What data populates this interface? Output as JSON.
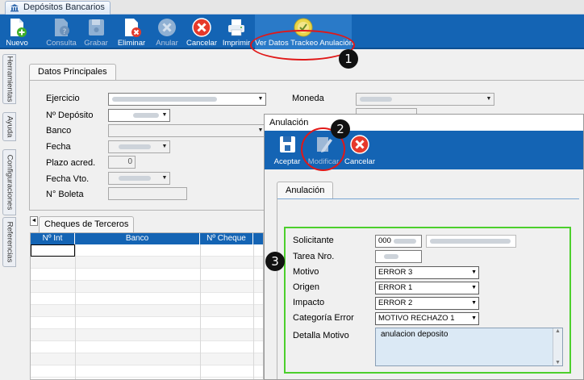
{
  "window": {
    "tab_title": "Depósitos Bancarios"
  },
  "toolbar": {
    "buttons": [
      {
        "label": "Nuevo",
        "icon": "new-document-icon"
      },
      {
        "label": "Consulta",
        "icon": "query-icon"
      },
      {
        "label": "Grabar",
        "icon": "save-icon"
      },
      {
        "label": "Eliminar",
        "icon": "delete-document-icon"
      },
      {
        "label": "Anular",
        "icon": "cancel-x-icon"
      },
      {
        "label": "Cancelar",
        "icon": "cancel-icon"
      },
      {
        "label": "Imprimir",
        "icon": "printer-icon"
      },
      {
        "label": "Ver Datos Trackeo Anulación",
        "icon": "tracking-icon"
      }
    ]
  },
  "annotations": {
    "step1": "1",
    "step2": "2",
    "step3": "3"
  },
  "side_tabs": [
    "Herramientas",
    "Ayuda",
    "Configuraciones",
    "Referencias"
  ],
  "main": {
    "group_title": "Datos Principales",
    "fields": {
      "ejercicio": "Ejercicio",
      "deposito": "Nº Depósito",
      "banco": "Banco",
      "fecha": "Fecha",
      "plazo": "Plazo acred.",
      "plazo_value": "0",
      "fecha_vto": "Fecha Vto.",
      "boleta": "N° Boleta",
      "moneda": "Moneda"
    },
    "cheques": {
      "title": "Cheques de Terceros",
      "scroll_arrow": "◄",
      "columns": [
        "Nº Int",
        "Banco",
        "Nº Cheque"
      ]
    }
  },
  "dialog": {
    "title": "Anulación",
    "buttons": [
      {
        "label": "Aceptar",
        "icon": "save-icon"
      },
      {
        "label": "Modificar",
        "icon": "edit-icon"
      },
      {
        "label": "Cancelar",
        "icon": "cancel-icon"
      }
    ],
    "tab": "Anulación",
    "fields": {
      "solicitante": "Solicitante",
      "solicitante_value": "000",
      "tarea": "Tarea Nro.",
      "motivo": "Motivo",
      "motivo_value": "ERROR 3",
      "origen": "Origen",
      "origen_value": "ERROR 1",
      "impacto": "Impacto",
      "impacto_value": "ERROR 2",
      "categoria": "Categoría Error",
      "categoria_value": "MOTIVO RECHAZO 1",
      "detalle": "Detalla Motivo",
      "detalle_value": "anulacion deposito"
    }
  },
  "colors": {
    "toolbar": "#1464b4",
    "annotation_red": "#e01818",
    "highlight_green": "#4ccf2c"
  }
}
